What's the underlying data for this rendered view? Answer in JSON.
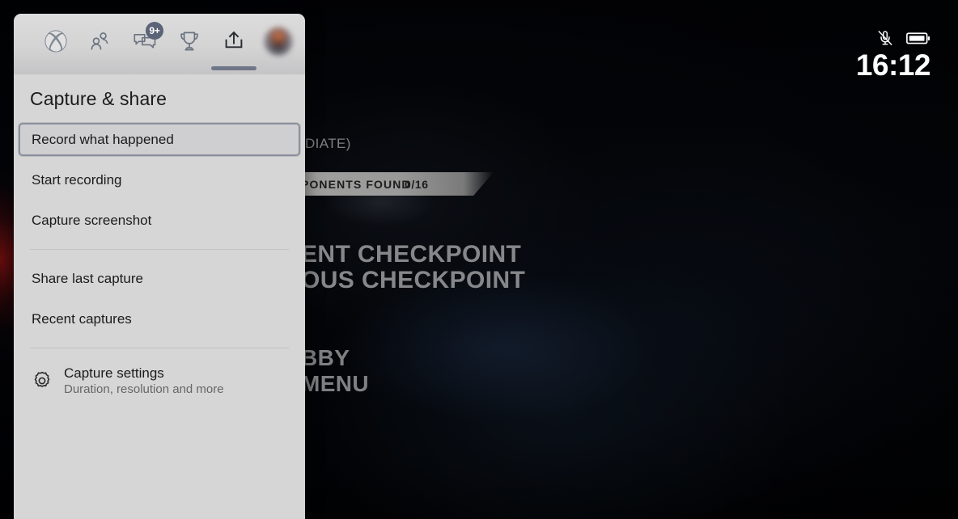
{
  "status_bar": {
    "microphone_icon": "microphone-muted-icon",
    "battery_icon": "battery-icon",
    "clock": "16:12"
  },
  "game": {
    "difficulty_text": "RMEDIATE)",
    "objective_label": "PONENTS FOUND",
    "objective_count": "0/16",
    "checkpoint_current": "ENT CHECKPOINT",
    "checkpoint_previous": "OUS CHECKPOINT",
    "lobby": "BBY",
    "menu": "MENU"
  },
  "gamebar": {
    "toolbar": [
      {
        "name": "xbox-logo-button",
        "icon": "xbox-icon",
        "label": "Xbox",
        "active": false,
        "badge": null
      },
      {
        "name": "friends-button",
        "icon": "people-icon",
        "label": "Friends",
        "active": false,
        "badge": null
      },
      {
        "name": "chat-button",
        "icon": "chat-bubbles-icon",
        "label": "Chat",
        "active": false,
        "badge": "9+"
      },
      {
        "name": "achievements-button",
        "icon": "trophy-icon",
        "label": "Achievements",
        "active": false,
        "badge": null
      },
      {
        "name": "capture-share-button",
        "icon": "upload-share-icon",
        "label": "Capture & share",
        "active": true,
        "badge": null
      },
      {
        "name": "profile-button",
        "icon": "avatar-icon",
        "label": "Profile",
        "active": false,
        "badge": null
      }
    ],
    "panel_title": "Capture & share",
    "menu_items": [
      {
        "label": "Record what happened",
        "selected": true
      },
      {
        "label": "Start recording",
        "selected": false
      },
      {
        "label": "Capture screenshot",
        "selected": false
      }
    ],
    "share_items": [
      {
        "label": "Share last capture",
        "selected": false
      },
      {
        "label": "Recent captures",
        "selected": false
      }
    ],
    "settings": {
      "icon": "gear-icon",
      "title": "Capture settings",
      "subtitle": "Duration, resolution and more"
    }
  },
  "colors": {
    "panel_background": "#d6d6d6",
    "panel_header": "#dcdcdc",
    "selection_border": "#8b909d",
    "selection_fill": "#cfcfd1",
    "active_indicator": "#6e7687",
    "badge_background": "#5a6377",
    "icon_gray": "#6b7280",
    "text_primary": "#1b1b1b",
    "text_secondary": "#666666",
    "divider": "#c2c2c2",
    "clock_text": "#ffffff"
  }
}
